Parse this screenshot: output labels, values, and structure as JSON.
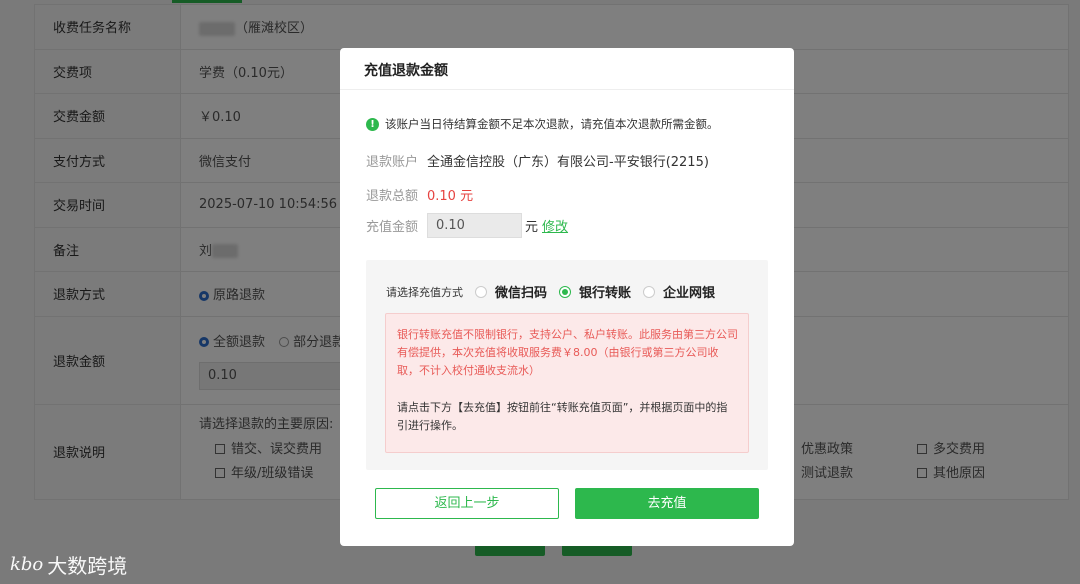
{
  "background": {
    "rows": [
      {
        "label": "收费任务名称",
        "value": "（雁滩校区）"
      },
      {
        "label": "交费项",
        "value": "学费（0.10元）"
      },
      {
        "label": "交费金额",
        "value": "￥0.10"
      },
      {
        "label": "支付方式",
        "value": "微信支付"
      },
      {
        "label": "交易时间",
        "value": "2025-07-10 10:54:56"
      },
      {
        "label": "备注",
        "value": "刘"
      },
      {
        "label": "退款方式",
        "value": "原路退款"
      },
      {
        "label": "退款金额",
        "option_full": "全额退款",
        "option_partial": "部分退款",
        "amount": "0.10"
      },
      {
        "label": "退款说明",
        "reason_prompt": "请选择退款的主要原因:"
      }
    ],
    "reasons": {
      "left_top": "错交、误交费用",
      "left_bottom": "年级/班级错误",
      "mid_top": "优惠政策",
      "mid_bottom": "测试退款",
      "right_top": "多交费用",
      "right_bottom": "其他原因"
    }
  },
  "watermark": {
    "logo": "kbo",
    "text": "大数跨境"
  },
  "modal": {
    "title": "充值退款金额",
    "notice": "该账户当日待结算金额不足本次退款，请充值本次退款所需金额。",
    "account_label": "退款账户",
    "account_value": "全通金信控股（广东）有限公司-平安银行(2215)",
    "total_label": "退款总额",
    "total_value": "0.10 元",
    "recharge_label": "充值金额",
    "recharge_value": "0.10",
    "recharge_unit": "元",
    "edit_link": "修改",
    "method_prompt": "请选择充值方式",
    "methods": [
      "微信扫码",
      "银行转账",
      "企业网银"
    ],
    "selected_method": "银行转账",
    "warning_text": "银行转账充值不限制银行，支持公户、私户转账。此服务由第三方公司有偿提供，本次充值将收取服务费￥8.00（由银行或第三方公司收取，不计入校付通收支流水）",
    "guide_text": "请点击下方【去充值】按钮前往“转账充值页面”，并根据页面中的指引进行操作。",
    "back_button": "返回上一步",
    "go_button": "去充值"
  },
  "colors": {
    "accent": "#2db84d",
    "warning": "#e85a57",
    "amount": "#e64340"
  }
}
